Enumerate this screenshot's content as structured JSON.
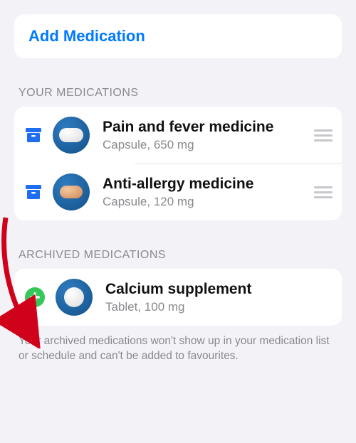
{
  "addMedication": {
    "label": "Add Medication"
  },
  "sections": {
    "your": {
      "header": "YOUR MEDICATIONS"
    },
    "archived": {
      "header": "ARCHIVED MEDICATIONS"
    }
  },
  "medications": {
    "your": [
      {
        "name": "Pain and fever medicine",
        "detail": "Capsule, 650 mg"
      },
      {
        "name": "Anti-allergy medicine",
        "detail": "Capsule, 120 mg"
      }
    ],
    "archived": [
      {
        "name": "Calcium supplement",
        "detail": "Tablet, 100 mg"
      }
    ]
  },
  "footnote": "Your archived medications won't show up in your medication list or schedule and can't be added to favourites.",
  "colors": {
    "accent": "#007aff",
    "addGreen": "#34c759",
    "arrow": "#d0021b"
  }
}
